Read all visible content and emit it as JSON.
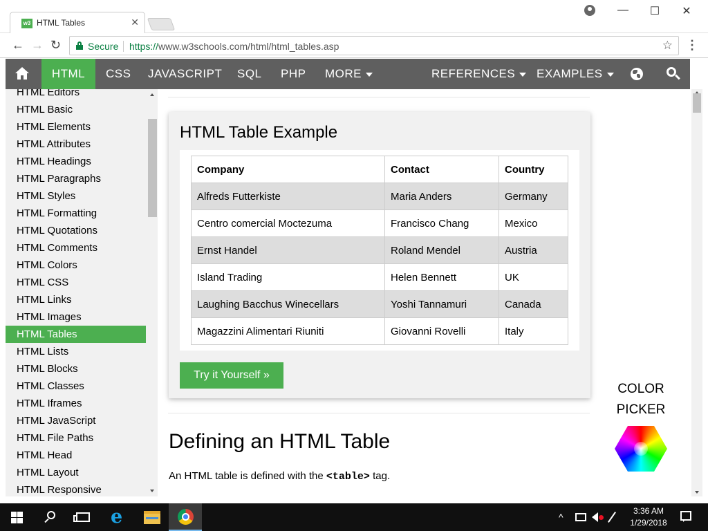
{
  "browser": {
    "tab_title": "HTML Tables",
    "tab_favicon_text": "w3",
    "tab_close": "✕",
    "window_controls": {
      "minimize": "—",
      "maximize": "☐",
      "close": "✕"
    },
    "secure_label": "Secure",
    "url_scheme": "https://",
    "url_rest": "www.w3schools.com/html/html_tables.asp",
    "back": "←",
    "forward": "→",
    "reload": "↻",
    "star": "☆",
    "menu": "⋮"
  },
  "topnav": {
    "items": [
      {
        "label": "HTML",
        "active": true
      },
      {
        "label": "CSS"
      },
      {
        "label": "JAVASCRIPT"
      },
      {
        "label": "SQL"
      },
      {
        "label": "PHP"
      },
      {
        "label": "MORE"
      },
      {
        "label": "REFERENCES"
      },
      {
        "label": "EXAMPLES"
      }
    ]
  },
  "sidebar": {
    "items": [
      {
        "label": "HTML Editors"
      },
      {
        "label": "HTML Basic"
      },
      {
        "label": "HTML Elements"
      },
      {
        "label": "HTML Attributes"
      },
      {
        "label": "HTML Headings"
      },
      {
        "label": "HTML Paragraphs"
      },
      {
        "label": "HTML Styles"
      },
      {
        "label": "HTML Formatting"
      },
      {
        "label": "HTML Quotations"
      },
      {
        "label": "HTML Comments"
      },
      {
        "label": "HTML Colors"
      },
      {
        "label": "HTML CSS"
      },
      {
        "label": "HTML Links"
      },
      {
        "label": "HTML Images"
      },
      {
        "label": "HTML Tables",
        "active": true
      },
      {
        "label": "HTML Lists"
      },
      {
        "label": "HTML Blocks"
      },
      {
        "label": "HTML Classes"
      },
      {
        "label": "HTML Iframes"
      },
      {
        "label": "HTML JavaScript"
      },
      {
        "label": "HTML File Paths"
      },
      {
        "label": "HTML Head"
      },
      {
        "label": "HTML Layout"
      },
      {
        "label": "HTML Responsive"
      }
    ]
  },
  "main": {
    "example_title": "HTML Table Example",
    "table": {
      "headers": [
        "Company",
        "Contact",
        "Country"
      ],
      "rows": [
        [
          "Alfreds Futterkiste",
          "Maria Anders",
          "Germany"
        ],
        [
          "Centro comercial Moctezuma",
          "Francisco Chang",
          "Mexico"
        ],
        [
          "Ernst Handel",
          "Roland Mendel",
          "Austria"
        ],
        [
          "Island Trading",
          "Helen Bennett",
          "UK"
        ],
        [
          "Laughing Bacchus Winecellars",
          "Yoshi Tannamuri",
          "Canada"
        ],
        [
          "Magazzini Alimentari Riuniti",
          "Giovanni Rovelli",
          "Italy"
        ]
      ]
    },
    "try_button": "Try it Yourself »",
    "section_title": "Defining an HTML Table",
    "para_before": "An HTML table is defined with the ",
    "para_code": "<table>",
    "para_after": " tag."
  },
  "color_picker": {
    "line1": "COLOR",
    "line2": "PICKER"
  },
  "taskbar": {
    "clock_time": "3:36 AM",
    "clock_date": "1/29/2018",
    "tray_chevron": "^"
  },
  "colors": {
    "accent": "#4CAF50",
    "nav_bg": "#5f5f5f",
    "sidebar_bg": "#f1f1f1",
    "table_shade": "#dddddd"
  }
}
